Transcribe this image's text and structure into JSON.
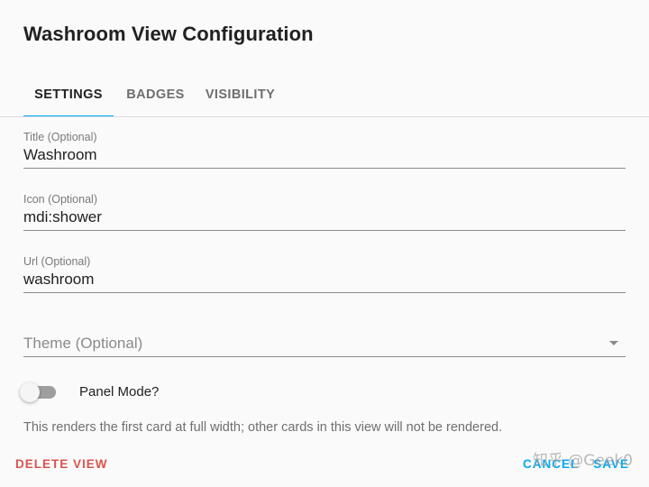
{
  "dialog": {
    "title": "Washroom View Configuration"
  },
  "tabs": [
    {
      "label": "SETTINGS",
      "active": true
    },
    {
      "label": "BADGES",
      "active": false
    },
    {
      "label": "VISIBILITY",
      "active": false
    }
  ],
  "fields": {
    "title": {
      "label": "Title (Optional)",
      "value": "Washroom"
    },
    "icon": {
      "label": "Icon (Optional)",
      "value": "mdi:shower"
    },
    "url": {
      "label": "Url (Optional)",
      "value": "washroom"
    }
  },
  "theme": {
    "placeholder": "Theme (Optional)",
    "selected": ""
  },
  "panel_mode": {
    "label": "Panel Mode?",
    "checked": false,
    "helper": "This renders the first card at full width; other cards in this view will not be rendered."
  },
  "footer": {
    "delete_label": "DELETE VIEW",
    "cancel_label": "CANCEL",
    "save_label": "SAVE"
  },
  "watermark": "知乎 @Geek0",
  "colors": {
    "accent": "#03a9f4",
    "delete": "#d9534f",
    "toggle_off_track": "#9e9e9e"
  }
}
